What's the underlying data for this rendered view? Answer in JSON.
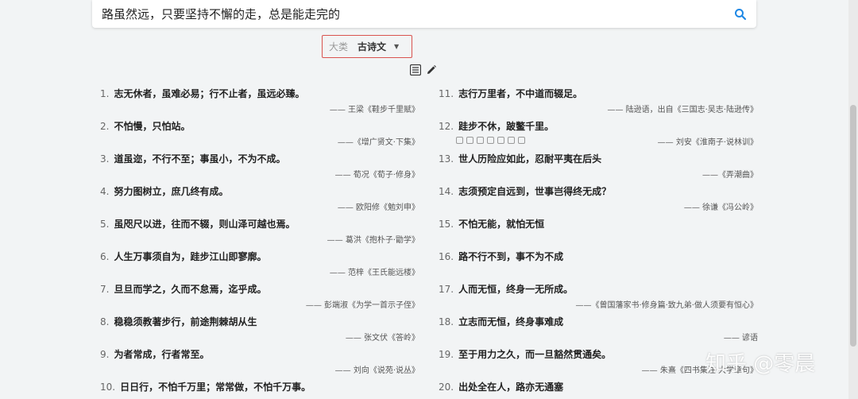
{
  "search": {
    "value": "路虽然远，只要坚持不懈的走，总是能走完的",
    "placeholder": ""
  },
  "category": {
    "label": "大类",
    "value": "古诗文"
  },
  "colors": {
    "accent": "#1e88e5",
    "highlight_border": "#d9534f"
  },
  "left_items": [
    {
      "num": "1.",
      "text": "志无休者，虽难必易；行不止者，虽远必臻。",
      "src": "—— 王梁《鞋步千里赋》"
    },
    {
      "num": "2.",
      "text": "不怕慢，只怕站。",
      "src": "——《增广贤文·下集》"
    },
    {
      "num": "3.",
      "text": "道虽迩，不行不至；事虽小，不为不成。",
      "src": "—— 荀况《荀子·修身》"
    },
    {
      "num": "4.",
      "text": "努力图树立，庶几终有成。",
      "src": "—— 欧阳修《勉刘申》"
    },
    {
      "num": "5.",
      "text": "虽咫尺以进，往而不辍，则山泽可越也焉。",
      "src": "—— 葛洪《抱朴子·勖学》"
    },
    {
      "num": "6.",
      "text": "人生万事须自为，跬步江山即寥廓。",
      "src": "—— 范梓《王氏能远楼》"
    },
    {
      "num": "7.",
      "text": "旦旦而学之，久而不怠焉，迄乎成。",
      "src": "—— 彭端淑《为学一首示子侄》"
    },
    {
      "num": "8.",
      "text": "稳稳须教著步行，前途荆棘胡从生",
      "src": "—— 张文伏《答岭》"
    },
    {
      "num": "9.",
      "text": "为者常成，行者常至。",
      "src": "—— 刘向《说苑·说丛》"
    },
    {
      "num": "10.",
      "text": "日日行，不怕千万里；常常做，不怕千万事。",
      "src": ""
    }
  ],
  "right_items": [
    {
      "num": "11.",
      "text": "志行万里者，不中道而辍足。",
      "src": "—— 陆逊语，出自《三国志·吴志·陆逊传》"
    },
    {
      "num": "12.",
      "text": "跬步不休，跛鳖千里。",
      "src": "—— 刘安《淮南子·说林训》"
    },
    {
      "num": "13.",
      "text": "世人历险应如此，忍耐平夷在后头",
      "src": "——《弄潮曲》"
    },
    {
      "num": "14.",
      "text": "志须预定自远到，世事岂得终无成？",
      "src": "—— 徐谦《冯公岭》"
    },
    {
      "num": "15.",
      "text": "不怕无能，就怕无恒",
      "src": ""
    },
    {
      "num": "16.",
      "text": "路不行不到，事不为不成",
      "src": ""
    },
    {
      "num": "17.",
      "text": "人而无恒，终身一无所成。",
      "src": "——《曾国藩家书·修身篇·致九弟·做人须要有恒心》"
    },
    {
      "num": "18.",
      "text": "立志而无恒，终身事难成",
      "src": "—— 谚语"
    },
    {
      "num": "19.",
      "text": "至于用力之久，而一旦豁然贯通矣。",
      "src": "—— 朱熹《四书集注·大学章句》"
    },
    {
      "num": "20.",
      "text": "出处全在人，路亦无通塞",
      "src": ""
    }
  ],
  "watermark": "知乎 @零晨"
}
